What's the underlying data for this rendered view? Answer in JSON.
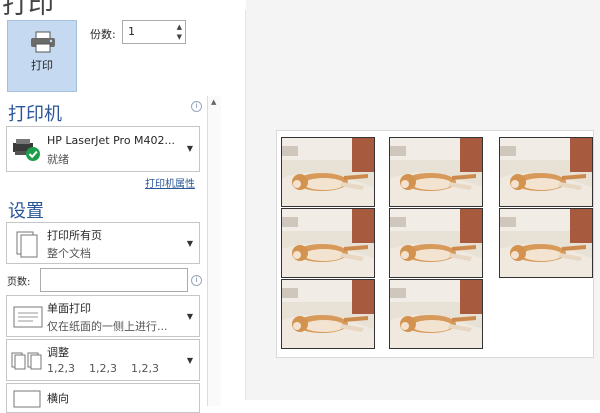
{
  "page": {
    "title": "打印"
  },
  "print_button": {
    "label": "打印",
    "icon": "printer-icon"
  },
  "copies": {
    "label": "份数:",
    "value": "1"
  },
  "printer_section": {
    "heading": "打印机",
    "printer_name": "HP LaserJet Pro M402...",
    "status": "就绪",
    "properties_link": "打印机属性"
  },
  "settings_section": {
    "heading": "设置",
    "pages_dropdown": {
      "title": "打印所有页",
      "subtitle": "整个文档"
    },
    "pages_field": {
      "label": "页数:",
      "value": ""
    },
    "sides_dropdown": {
      "title": "单面打印",
      "subtitle": "仅在纸面的一侧上进行..."
    },
    "collate_dropdown": {
      "title": "调整",
      "subtitle": "1,2,3    1,2,3    1,2,3"
    },
    "orientation_dropdown": {
      "title": "横向"
    }
  },
  "preview": {
    "thumbnail_count": 8,
    "colors": {
      "paper": "#ffffff",
      "background": "#f4f4f4",
      "accent": "#2b579a"
    }
  }
}
